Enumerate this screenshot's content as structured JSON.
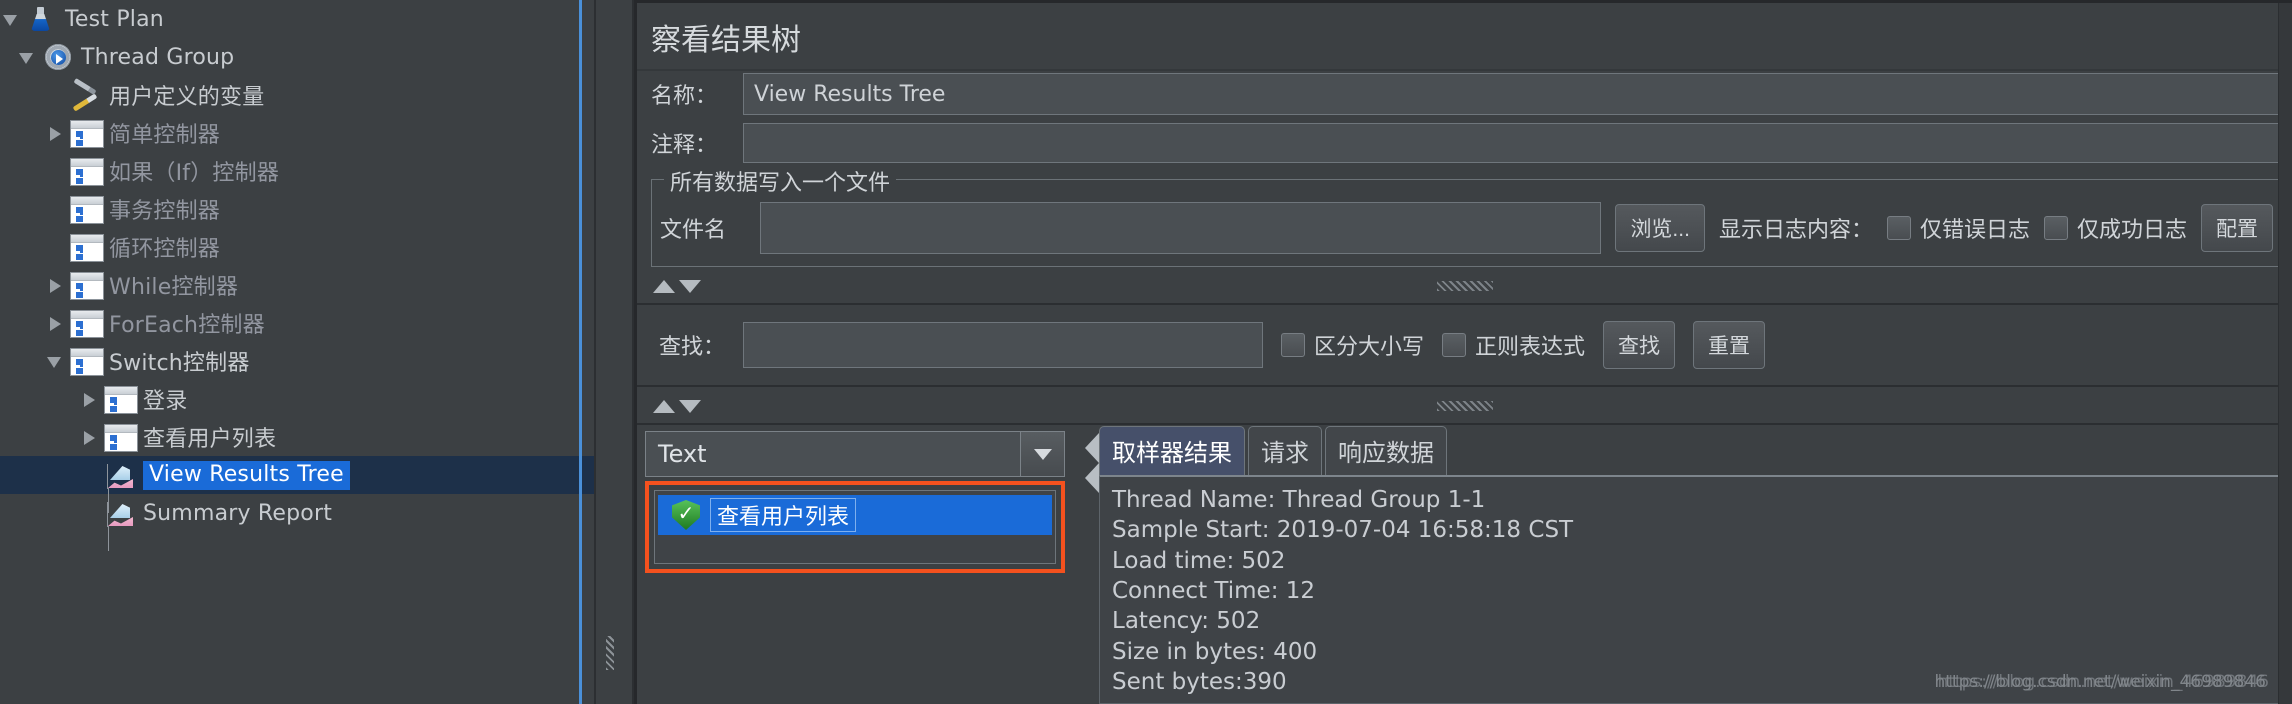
{
  "tree": {
    "nodes": [
      {
        "label": "Test Plan",
        "icon": "flask-icon",
        "indent": 0,
        "twisty": "expanded",
        "state": "normal"
      },
      {
        "label": "Thread Group",
        "icon": "gear-icon",
        "indent": 1,
        "twisty": "expanded",
        "state": "normal"
      },
      {
        "label": "用户定义的变量",
        "icon": "tools-icon",
        "indent": 2,
        "twisty": "none",
        "state": "normal"
      },
      {
        "label": "简单控制器",
        "icon": "controller-icon",
        "indent": 2,
        "twisty": "collapsed",
        "state": "dim"
      },
      {
        "label": "如果（If）控制器",
        "icon": "controller-icon",
        "indent": 2,
        "twisty": "none",
        "state": "dim"
      },
      {
        "label": "事务控制器",
        "icon": "controller-icon",
        "indent": 2,
        "twisty": "none",
        "state": "dim"
      },
      {
        "label": "循环控制器",
        "icon": "controller-icon",
        "indent": 2,
        "twisty": "none",
        "state": "dim"
      },
      {
        "label": "While控制器",
        "icon": "controller-icon",
        "indent": 2,
        "twisty": "collapsed",
        "state": "dim"
      },
      {
        "label": "ForEach控制器",
        "icon": "controller-icon",
        "indent": 2,
        "twisty": "collapsed",
        "state": "dim"
      },
      {
        "label": "Switch控制器",
        "icon": "controller-icon",
        "indent": 2,
        "twisty": "expanded",
        "state": "normal"
      },
      {
        "label": "登录",
        "icon": "controller-icon",
        "indent": 3,
        "twisty": "collapsed",
        "state": "normal"
      },
      {
        "label": "查看用户列表",
        "icon": "controller-icon",
        "indent": 3,
        "twisty": "collapsed",
        "state": "normal"
      },
      {
        "label": "View Results Tree",
        "icon": "listener-icon",
        "indent": 3,
        "twisty": "none",
        "state": "selected"
      },
      {
        "label": "Summary Report",
        "icon": "listener-icon",
        "indent": 3,
        "twisty": "none",
        "state": "normal"
      }
    ]
  },
  "panel": {
    "title": "察看结果树",
    "name_label": "名称：",
    "name_value": "View Results Tree",
    "comment_label": "注释：",
    "comment_value": "",
    "filegroup": {
      "title": "所有数据写入一个文件",
      "filename_label": "文件名",
      "filename_value": "",
      "browse_button": "浏览...",
      "log_display_label": "显示日志内容：",
      "errors_only": "仅错误日志",
      "success_only": "仅成功日志",
      "configure_button": "配置"
    },
    "search": {
      "label": "查找：",
      "value": "",
      "case_sensitive": "区分大小写",
      "regex": "正则表达式",
      "find_button": "查找",
      "reset_button": "重置"
    },
    "renderer_selected": "Text",
    "result_entries": [
      {
        "label": "查看用户列表",
        "status": "success"
      }
    ],
    "tabs": [
      {
        "label": "取样器结果",
        "active": true
      },
      {
        "label": "请求",
        "active": false
      },
      {
        "label": "响应数据",
        "active": false
      }
    ],
    "sampler_result_lines": [
      "Thread Name: Thread Group 1-1",
      "Sample Start: 2019-07-04 16:58:18 CST",
      "Load time: 502",
      "Connect Time: 12",
      "Latency: 502",
      "Size in bytes: 400",
      "Sent bytes:390"
    ]
  },
  "watermark": "https://blog.csdn.net/weixin_46989846",
  "colors": {
    "background": "#3c4043",
    "selection_blue": "#1a6bd8",
    "selection_row": "#1d3049",
    "highlight_orange": "#f4511e",
    "tab_active": "#46506a",
    "edge_blue": "#4a90d9"
  }
}
